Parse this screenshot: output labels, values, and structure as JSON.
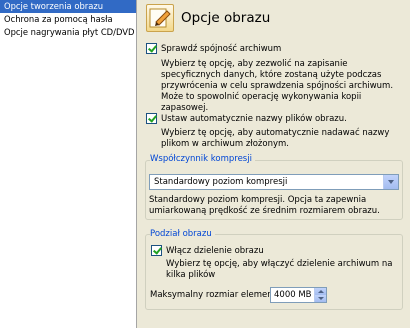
{
  "nav": {
    "items": [
      {
        "label": "Opcje tworzenia obrazu",
        "selected": true
      },
      {
        "label": "Ochrona za pomocą hasła",
        "selected": false
      },
      {
        "label": "Opcje nagrywania płyt CD/DVD",
        "selected": false
      }
    ]
  },
  "header": {
    "title": "Opcje obrazu",
    "icon": "pencil-document-icon"
  },
  "verify": {
    "checked": true,
    "label": "Sprawdź spójność archiwum",
    "desc": "Wybierz tę opcję, aby zezwolić na zapisanie specyficznych danych, które zostaną użyte podczas przywrócenia w celu sprawdzenia spójności archiwum. Może to spowolnić operację wykonywania kopii zapasowej."
  },
  "autoname": {
    "checked": true,
    "label": "Ustaw automatycznie nazwy plików obrazu.",
    "desc": "Wybierz tę opcję, aby automatycznie nadawać nazwy plikom w archiwum złożonym."
  },
  "compression": {
    "title": "Współczynnik kompresji",
    "selected": "Standardowy poziom kompresji",
    "desc": "Standardowy poziom kompresji. Opcja ta zapewnia umiarkowaną prędkość ze średnim rozmiarem obrazu."
  },
  "split": {
    "title": "Podział obrazu",
    "checked": true,
    "label": "Włącz dzielenie obrazu",
    "desc": "Wybierz tę opcję, aby włączyć dzielenie archiwum na kilka plików",
    "max_label": "Maksymalny rozmiar elementu:",
    "max_value": "4000 MB"
  }
}
